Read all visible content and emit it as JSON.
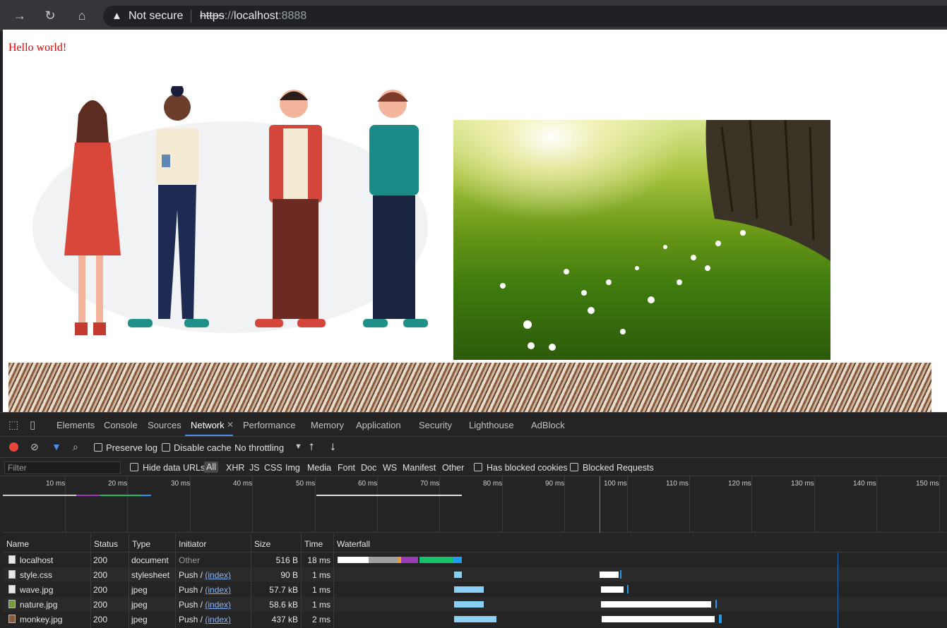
{
  "browser": {
    "security_label": "Not secure",
    "url_scheme": "https",
    "url_sep": "://",
    "url_host": "localhost",
    "url_port": ":8888"
  },
  "page": {
    "hello_text": "Hello world!"
  },
  "devtools": {
    "tabs": [
      "Elements",
      "Console",
      "Sources",
      "Network",
      "Performance",
      "Memory",
      "Application",
      "Security",
      "Lighthouse",
      "AdBlock"
    ],
    "active_tab": "Network",
    "controls": {
      "preserve_log": "Preserve log",
      "disable_cache": "Disable cache",
      "throttling": "No throttling"
    },
    "filter": {
      "placeholder": "Filter",
      "hide_data_urls": "Hide data URLs",
      "types": [
        "All",
        "XHR",
        "JS",
        "CSS",
        "Img",
        "Media",
        "Font",
        "Doc",
        "WS",
        "Manifest",
        "Other"
      ],
      "has_blocked_cookies": "Has blocked cookies",
      "blocked_requests": "Blocked Requests"
    },
    "overview_ticks": [
      "10 ms",
      "20 ms",
      "30 ms",
      "40 ms",
      "50 ms",
      "60 ms",
      "70 ms",
      "80 ms",
      "90 ms",
      "100 ms",
      "110 ms",
      "120 ms",
      "130 ms",
      "140 ms",
      "150 ms"
    ],
    "columns": {
      "name": "Name",
      "status": "Status",
      "type": "Type",
      "initiator": "Initiator",
      "size": "Size",
      "time": "Time",
      "waterfall": "Waterfall"
    },
    "rows": [
      {
        "name": "localhost",
        "status": "200",
        "type": "document",
        "initiator": "Other",
        "initiator_link": "",
        "size": "516 B",
        "time": "18 ms"
      },
      {
        "name": "style.css",
        "status": "200",
        "type": "stylesheet",
        "initiator": "Push / ",
        "initiator_link": "(index)",
        "size": "90 B",
        "time": "1 ms"
      },
      {
        "name": "wave.jpg",
        "status": "200",
        "type": "jpeg",
        "initiator": "Push / ",
        "initiator_link": "(index)",
        "size": "57.7 kB",
        "time": "1 ms"
      },
      {
        "name": "nature.jpg",
        "status": "200",
        "type": "jpeg",
        "initiator": "Push / ",
        "initiator_link": "(index)",
        "size": "58.6 kB",
        "time": "1 ms"
      },
      {
        "name": "monkey.jpg",
        "status": "200",
        "type": "jpeg",
        "initiator": "Push / ",
        "initiator_link": "(index)",
        "size": "437 kB",
        "time": "2 ms"
      }
    ]
  },
  "colors": {
    "accent_blue": "#4d8fef",
    "record_red": "#e8453c",
    "hello_red": "#e00000",
    "wf_receive": "#8ad0f5",
    "wf_download_blue": "#1e9cf0",
    "wf_green": "#14c26b",
    "wf_purple": "#9b3bb7"
  }
}
